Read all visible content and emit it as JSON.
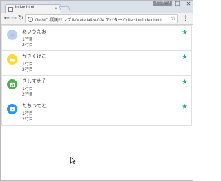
{
  "browser": {
    "tab_title": "index.html",
    "tab_close": "×",
    "profile_label": "ユーザー 1",
    "window_controls": {
      "minimize": "–",
      "maximize": "☐",
      "close": "✕"
    },
    "nav": {
      "back": "←",
      "forward": "→",
      "reload": "↻"
    },
    "address": {
      "info_glyph": "i",
      "url": "file:///C:/開発サンプル/Materialize/024.アバター Collection/index.html",
      "bookmark_glyph": "☆"
    },
    "menu_glyph": "⋮"
  },
  "collection": {
    "items": [
      {
        "title": "あいうえお",
        "line1": "1行目",
        "line2": "2行目",
        "avatar_icon": "image-icon",
        "avatar_color": "#b3d4f0",
        "avatar_glyph": "",
        "star": "★"
      },
      {
        "title": "かきくけこ",
        "line1": "1行目",
        "line2": "2行目",
        "avatar_icon": "folder-icon",
        "avatar_color": "#fdd835",
        "avatar_glyph": "▬",
        "star": "★"
      },
      {
        "title": "さしすせそ",
        "line1": "1行目",
        "line2": "2行目",
        "avatar_icon": "insert-chart-icon",
        "avatar_color": "#4caf50",
        "avatar_glyph": "▦",
        "star": "★"
      },
      {
        "title": "たちつてと",
        "line1": "1行目",
        "line2": "2行目",
        "avatar_icon": "play-arrow-icon",
        "avatar_color": "#2196f3",
        "avatar_glyph": "▶",
        "star": "★"
      }
    ],
    "star_color": "#26a69a"
  }
}
